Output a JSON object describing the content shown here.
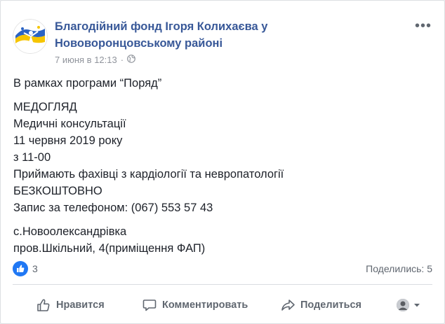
{
  "post": {
    "page_name": "Благодійний фонд Ігоря Колихаєва у Нововоронцовському районі",
    "timestamp": "7 июня в 12:13",
    "separator": "·",
    "privacy_icon": "globe-icon",
    "more_icon": "more-icon",
    "more_label": "•••",
    "text": {
      "intro": "В рамках програми “Поряд”",
      "lines": [
        "МЕДОГЛЯД",
        "Медичні консультації",
        "11 червня 2019 року",
        "з 11-00",
        "Приймають фахівці з кардіології та невропатології",
        "БЕЗКОШТОВНО",
        "Запис за телефоном: (067) 553 57 43"
      ],
      "address": [
        "с.Новоолександрівка",
        "пров.Шкільний, 4(приміщення ФАП)"
      ]
    }
  },
  "stats": {
    "reaction_icon": "like-icon",
    "likes_count": "3",
    "shares": "Поделились: 5"
  },
  "actions": {
    "like": "Нравится",
    "comment": "Комментировать",
    "share": "Поделиться"
  },
  "colors": {
    "link": "#385898",
    "muted": "#90949c",
    "like_blue": "#2078f4",
    "text": "#1d2129"
  }
}
